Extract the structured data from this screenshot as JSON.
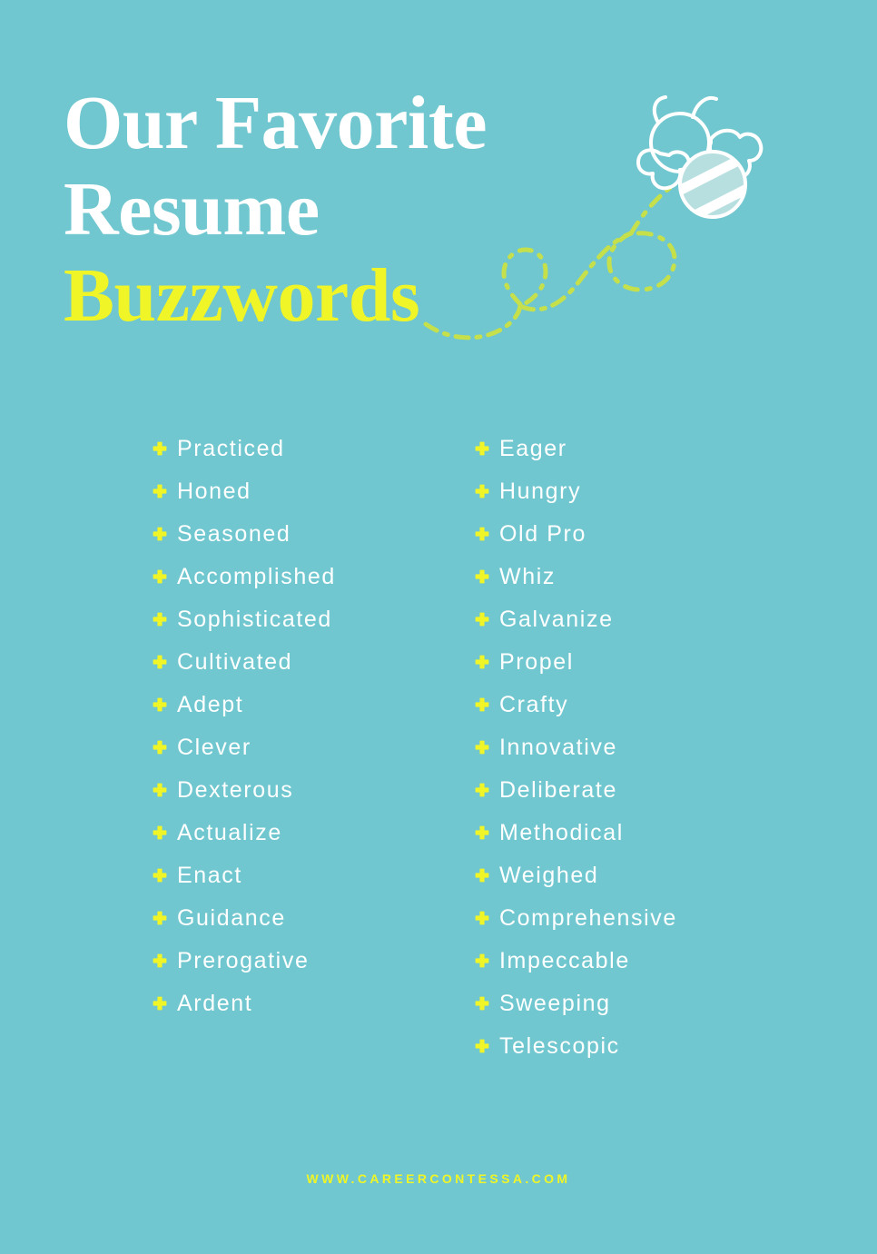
{
  "poster": {
    "background_color": "#71c7cf",
    "accent_yellow": "#eff526",
    "path_green": "#c5e04a",
    "text_white": "#ffffff",
    "bee_body_fill": "#b8dfe0"
  },
  "title": {
    "line1": "Our Favorite",
    "line2": "Resume",
    "line3": "Buzzwords"
  },
  "decoration": {
    "bee_icon": "bee-icon",
    "flight_path_icon": "dashed-flight-path-icon"
  },
  "word_list": {
    "bullet_icon": "plus-bullet-icon",
    "left_column": [
      "Practiced",
      "Honed",
      "Seasoned",
      "Accomplished",
      "Sophisticated",
      "Cultivated",
      "Adept",
      "Clever",
      "Dexterous",
      "Actualize",
      "Enact",
      "Guidance",
      "Prerogative",
      "Ardent"
    ],
    "right_column": [
      "Eager",
      "Hungry",
      "Old Pro",
      "Whiz",
      "Galvanize",
      "Propel",
      "Crafty",
      "Innovative",
      "Deliberate",
      "Methodical",
      "Weighed",
      "Comprehensive",
      "Impeccable",
      "Sweeping",
      "Telescopic"
    ]
  },
  "footer": {
    "url": "WWW.CAREERCONTESSA.COM"
  }
}
